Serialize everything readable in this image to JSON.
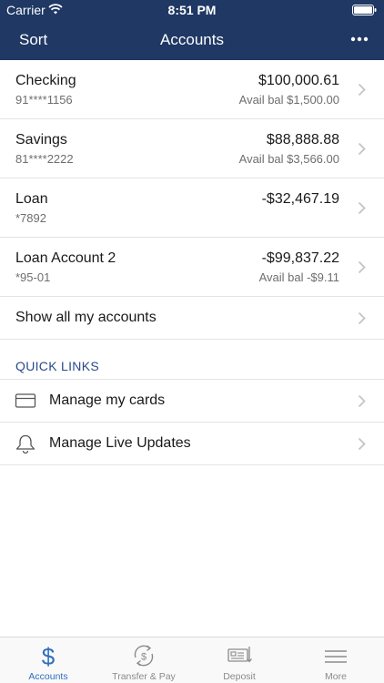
{
  "status_bar": {
    "carrier": "Carrier",
    "time": "8:51 PM"
  },
  "navbar": {
    "left_label": "Sort",
    "title": "Accounts"
  },
  "accounts": [
    {
      "name": "Checking",
      "number": "91****1156",
      "balance": "$100,000.61",
      "available": "Avail bal $1,500.00"
    },
    {
      "name": "Savings",
      "number": "81****2222",
      "balance": "$88,888.88",
      "available": "Avail bal $3,566.00"
    },
    {
      "name": "Loan",
      "number": "*7892",
      "balance": "-$32,467.19",
      "available": ""
    },
    {
      "name": "Loan Account 2",
      "number": "*95-01",
      "balance": "-$99,837.22",
      "available": "Avail bal -$9.11"
    }
  ],
  "show_all_label": "Show all my accounts",
  "quick_links": {
    "title": "QUICK LINKS",
    "items": [
      {
        "label": "Manage my cards",
        "icon": "credit-card-icon"
      },
      {
        "label": "Manage Live Updates",
        "icon": "bell-icon"
      }
    ]
  },
  "tabbar": {
    "tabs": [
      {
        "label": "Accounts",
        "icon": "dollar-icon",
        "active": true
      },
      {
        "label": "Transfer & Pay",
        "icon": "transfer-icon",
        "active": false
      },
      {
        "label": "Deposit",
        "icon": "deposit-check-icon",
        "active": false
      },
      {
        "label": "More",
        "icon": "menu-icon",
        "active": false
      }
    ]
  },
  "colors": {
    "header": "#1f3864",
    "accent": "#2f6fbf",
    "section_title": "#2a4b8a"
  }
}
